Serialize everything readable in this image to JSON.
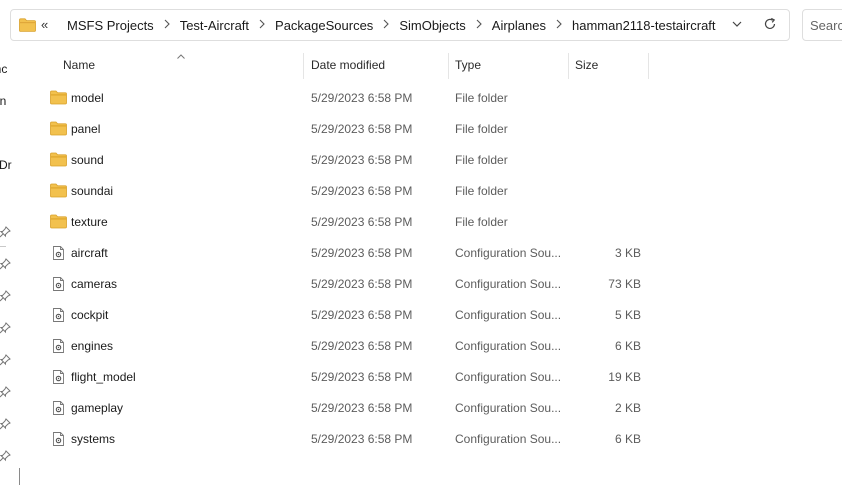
{
  "address_bar": {
    "overflow": "«",
    "crumbs": [
      "MSFS Projects",
      "Test-Aircraft",
      "PackageSources",
      "SimObjects",
      "Airplanes",
      "hamman2118-testaircraft"
    ],
    "separator_icon": "chevron-right-icon",
    "dropdown_icon": "chevron-down-icon",
    "refresh_icon": "refresh-icon"
  },
  "search": {
    "label": "Search"
  },
  "nav_pane": {
    "partial_labels": [
      "enc",
      "un",
      "Dr"
    ],
    "pin_icon_count": 8,
    "pin_icon": "pin-icon"
  },
  "columns": {
    "name": "Name",
    "date": "Date modified",
    "type": "Type",
    "size": "Size",
    "sort_icon": "sort-up-caret-icon"
  },
  "files": [
    {
      "name": "model",
      "date": "5/29/2023 6:58 PM",
      "type": "File folder",
      "size": "",
      "icon": "folder-icon"
    },
    {
      "name": "panel",
      "date": "5/29/2023 6:58 PM",
      "type": "File folder",
      "size": "",
      "icon": "folder-icon"
    },
    {
      "name": "sound",
      "date": "5/29/2023 6:58 PM",
      "type": "File folder",
      "size": "",
      "icon": "folder-icon"
    },
    {
      "name": "soundai",
      "date": "5/29/2023 6:58 PM",
      "type": "File folder",
      "size": "",
      "icon": "folder-icon"
    },
    {
      "name": "texture",
      "date": "5/29/2023 6:58 PM",
      "type": "File folder",
      "size": "",
      "icon": "folder-icon"
    },
    {
      "name": "aircraft",
      "date": "5/29/2023 6:58 PM",
      "type": "Configuration Sou...",
      "size": "3 KB",
      "icon": "config-file-icon"
    },
    {
      "name": "cameras",
      "date": "5/29/2023 6:58 PM",
      "type": "Configuration Sou...",
      "size": "73 KB",
      "icon": "config-file-icon"
    },
    {
      "name": "cockpit",
      "date": "5/29/2023 6:58 PM",
      "type": "Configuration Sou...",
      "size": "5 KB",
      "icon": "config-file-icon"
    },
    {
      "name": "engines",
      "date": "5/29/2023 6:58 PM",
      "type": "Configuration Sou...",
      "size": "6 KB",
      "icon": "config-file-icon"
    },
    {
      "name": "flight_model",
      "date": "5/29/2023 6:58 PM",
      "type": "Configuration Sou...",
      "size": "19 KB",
      "icon": "config-file-icon"
    },
    {
      "name": "gameplay",
      "date": "5/29/2023 6:58 PM",
      "type": "Configuration Sou...",
      "size": "2 KB",
      "icon": "config-file-icon"
    },
    {
      "name": "systems",
      "date": "5/29/2023 6:58 PM",
      "type": "Configuration Sou...",
      "size": "6 KB",
      "icon": "config-file-icon"
    }
  ],
  "colors": {
    "folder": "#F2C14E",
    "folder_dark": "#DFA52B",
    "divider": "#E5E5E5",
    "secondary_text": "#5C5C5C"
  }
}
